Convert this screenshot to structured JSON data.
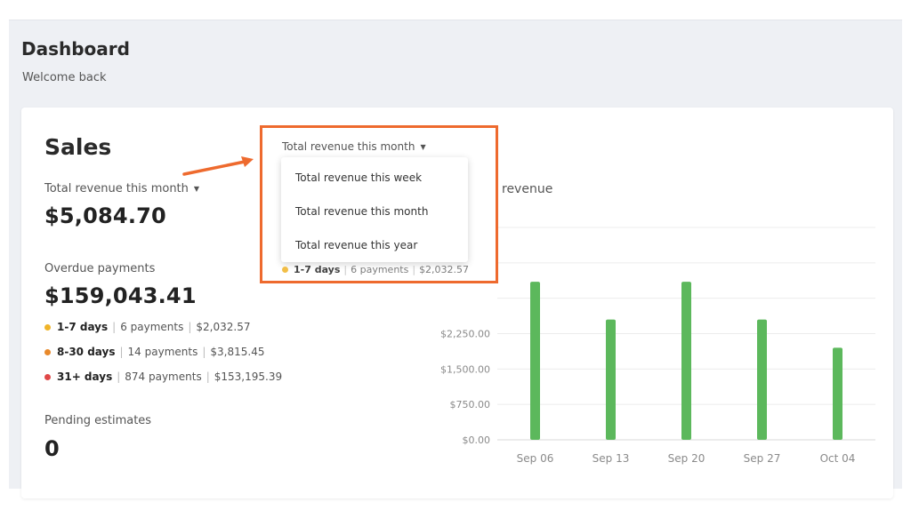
{
  "header": {
    "title": "Dashboard",
    "subtitle": "Welcome back"
  },
  "sales": {
    "title": "Sales",
    "revenue": {
      "label": "Total revenue this month",
      "value": "$5,084.70"
    },
    "overdue": {
      "label": "Overdue payments",
      "value": "$159,043.41",
      "rows": [
        {
          "range": "1-7 days",
          "payments": "6 payments",
          "amount": "$2,032.57",
          "color": "#f0b429"
        },
        {
          "range": "8-30 days",
          "payments": "14 payments",
          "amount": "$3,815.45",
          "color": "#e8892b"
        },
        {
          "range": "31+ days",
          "payments": "874 payments",
          "amount": "$153,195.39",
          "color": "#e04848"
        }
      ]
    },
    "pending": {
      "label": "Pending estimates",
      "value": "0"
    }
  },
  "dropdown": {
    "selected": "Total revenue this month",
    "options": [
      "Total revenue this week",
      "Total revenue this month",
      "Total revenue this year"
    ],
    "peek": {
      "range": "1-7 days",
      "payments": "6 payments",
      "amount": "$2,032.57",
      "color": "#f0b429"
    },
    "highlight_color": "#ee6a2e"
  },
  "chart_data": {
    "type": "bar",
    "title": "revenue",
    "categories": [
      "Sep 06",
      "Sep 13",
      "Sep 20",
      "Sep 27",
      "Oct 04"
    ],
    "values": [
      3350,
      2550,
      3350,
      2550,
      1950
    ],
    "ytick_values": [
      0,
      750,
      1500,
      2250
    ],
    "ytick_labels": [
      "$0.00",
      "$750.00",
      "$1,500.00",
      "$2,250.00"
    ],
    "ylim": [
      0,
      4500
    ],
    "grid": true,
    "bar_color": "#5cb85c"
  }
}
